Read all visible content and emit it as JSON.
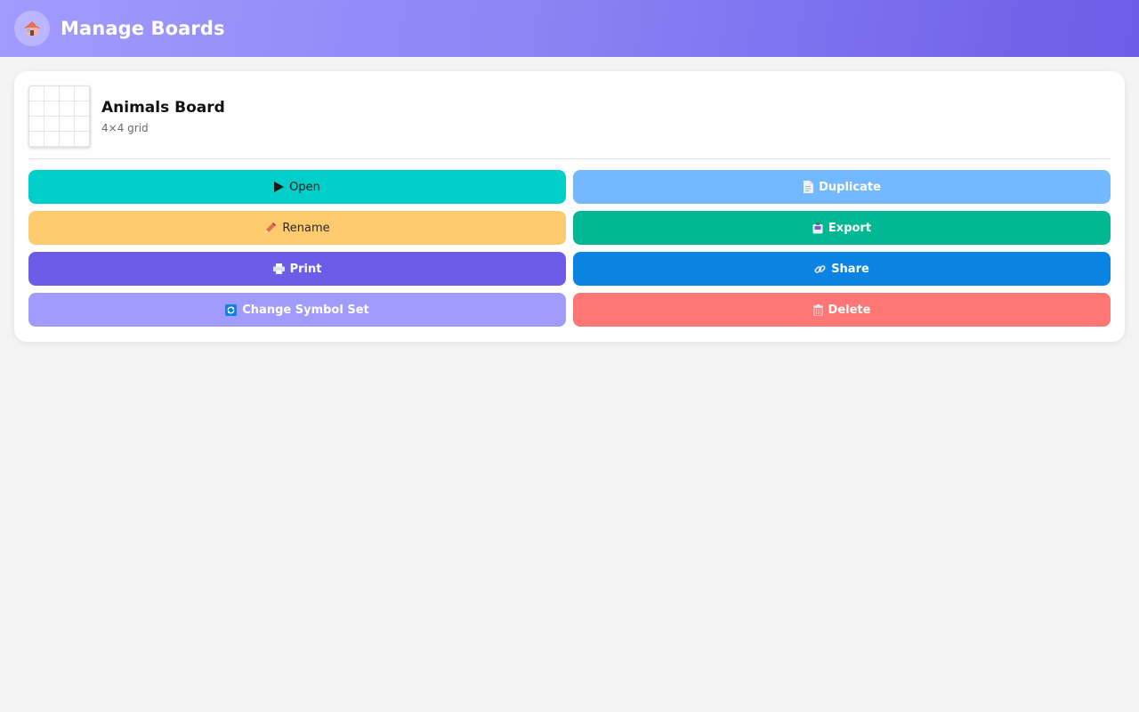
{
  "header": {
    "title": "Manage Boards",
    "home_icon": "home-icon"
  },
  "board": {
    "name": "Animals Board",
    "meta": "4×4 grid",
    "grid_rows": 4,
    "grid_cols": 4
  },
  "actions": {
    "open": {
      "label": "Open",
      "icon": "play-icon",
      "color": "#00cec9"
    },
    "duplicate": {
      "label": "Duplicate",
      "icon": "document-icon",
      "color": "#74b9ff"
    },
    "rename": {
      "label": "Rename",
      "icon": "pencil-icon",
      "color": "#fdcb6e"
    },
    "export": {
      "label": "Export",
      "icon": "export-icon",
      "color": "#00b894"
    },
    "print": {
      "label": "Print",
      "icon": "printer-icon",
      "color": "#6c5ce7"
    },
    "share": {
      "label": "Share",
      "icon": "link-icon",
      "color": "#0984e3"
    },
    "change_symbol_set": {
      "label": "Change Symbol Set",
      "icon": "refresh-icon",
      "color": "#a29bfe"
    },
    "delete": {
      "label": "Delete",
      "icon": "trash-icon",
      "color": "#ff7675"
    }
  }
}
